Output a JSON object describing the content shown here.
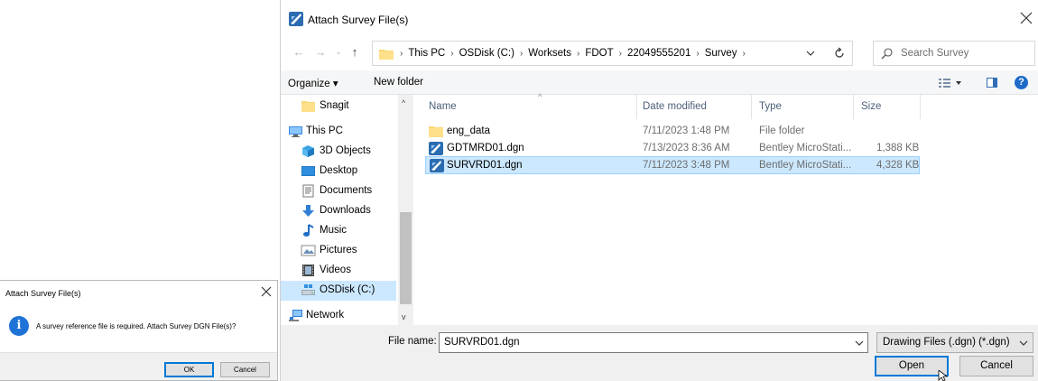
{
  "message_dialog": {
    "title": "Attach Survey File(s)",
    "message": "A survey reference file is required. Attach Survey DGN File(s)?",
    "ok_label": "OK",
    "cancel_label": "Cancel"
  },
  "file_dialog": {
    "title": "Attach Survey File(s)",
    "breadcrumbs": [
      "This PC",
      "OSDisk (C:)",
      "Worksets",
      "FDOT",
      "22049555201",
      "Survey"
    ],
    "search_placeholder": "Search Survey",
    "toolbar": {
      "organize_label": "Organize ▾",
      "new_folder_label": "New folder"
    },
    "nav_items": [
      {
        "label": "Snagit",
        "icon": "folder-icon",
        "level": 1
      },
      {
        "label": "This PC",
        "icon": "computer-icon",
        "level": 0
      },
      {
        "label": "3D Objects",
        "icon": "3d-objects-icon",
        "level": 1
      },
      {
        "label": "Desktop",
        "icon": "desktop-icon",
        "level": 1
      },
      {
        "label": "Documents",
        "icon": "documents-icon",
        "level": 1
      },
      {
        "label": "Downloads",
        "icon": "downloads-icon",
        "level": 1
      },
      {
        "label": "Music",
        "icon": "music-icon",
        "level": 1
      },
      {
        "label": "Pictures",
        "icon": "pictures-icon",
        "level": 1
      },
      {
        "label": "Videos",
        "icon": "videos-icon",
        "level": 1
      },
      {
        "label": "OSDisk (C:)",
        "icon": "drive-icon",
        "level": 1,
        "selected": true
      },
      {
        "label": "Network",
        "icon": "network-icon",
        "level": 0
      }
    ],
    "columns": [
      "Name",
      "Date modified",
      "Type",
      "Size"
    ],
    "files": [
      {
        "name": "eng_data",
        "date": "7/11/2023 1:48 PM",
        "type": "File folder",
        "size": "",
        "icon": "folder-icon"
      },
      {
        "name": "GDTMRD01.dgn",
        "date": "7/13/2023 8:36 AM",
        "type": "Bentley MicroStati...",
        "size": "1,388 KB",
        "icon": "dgn-file-icon"
      },
      {
        "name": "SURVRD01.dgn",
        "date": "7/11/2023 3:48 PM",
        "type": "Bentley MicroStati...",
        "size": "4,328 KB",
        "icon": "dgn-file-icon",
        "selected": true
      }
    ],
    "file_name_label": "File name:",
    "file_name_value": "SURVRD01.dgn",
    "file_type_value": "Drawing Files (.dgn) (*.dgn)",
    "open_label": "Open",
    "cancel_label": "Cancel"
  },
  "colors": {
    "selection": "#cce8ff",
    "accent": "#0078d7",
    "folder": "#f8d775"
  }
}
